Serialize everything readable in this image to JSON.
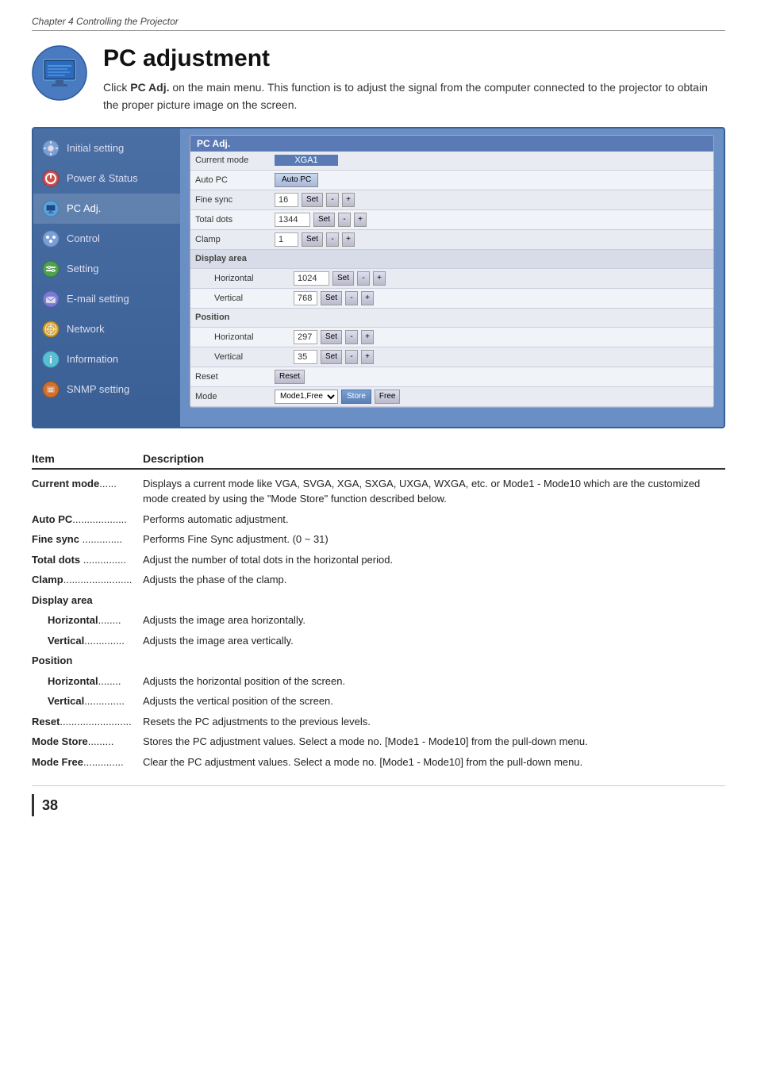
{
  "chapter": "Chapter 4 Controlling the Projector",
  "page_title": "PC adjustment",
  "intro": {
    "bold_part": "PC Adj.",
    "text": " on the main menu. This function is to adjust the signal from the computer connected to the projector to obtain the proper picture image on the screen."
  },
  "intro_prefix": "Click ",
  "sidebar": {
    "items": [
      {
        "id": "initial-setting",
        "label": "Initial setting",
        "icon": "gear"
      },
      {
        "id": "power-status",
        "label": "Power & Status",
        "icon": "power"
      },
      {
        "id": "pc-adj",
        "label": "PC Adj.",
        "icon": "monitor",
        "active": true
      },
      {
        "id": "control",
        "label": "Control",
        "icon": "control"
      },
      {
        "id": "setting",
        "label": "Setting",
        "icon": "setting"
      },
      {
        "id": "email-setting",
        "label": "E-mail setting",
        "icon": "email"
      },
      {
        "id": "network",
        "label": "Network",
        "icon": "network"
      },
      {
        "id": "information",
        "label": "Information",
        "icon": "info"
      },
      {
        "id": "snmp-setting",
        "label": "SNMP setting",
        "icon": "snmp"
      }
    ]
  },
  "panel": {
    "title": "PC Adj.",
    "rows": [
      {
        "type": "row",
        "label": "Current mode",
        "value": "XGA1",
        "value_type": "badge"
      },
      {
        "type": "row",
        "label": "Auto PC",
        "value": "Auto PC",
        "value_type": "button"
      },
      {
        "type": "row",
        "label": "Fine sync",
        "value": "16",
        "has_set": true,
        "has_pm": true
      },
      {
        "type": "row",
        "label": "Total dots",
        "value": "1344",
        "has_set": true,
        "has_pm": true
      },
      {
        "type": "row",
        "label": "Clamp",
        "value": "1",
        "has_set": true,
        "has_pm": true
      },
      {
        "type": "section",
        "label": "Display area"
      },
      {
        "type": "sub-row",
        "sub_label": "Horizontal",
        "value": "1024",
        "has_set": true,
        "has_pm": true
      },
      {
        "type": "sub-row",
        "sub_label": "Vertical",
        "value": "768",
        "has_set": true,
        "has_pm": true
      },
      {
        "type": "section",
        "label": "Position"
      },
      {
        "type": "sub-row",
        "sub_label": "Horizontal",
        "value": "297",
        "has_set": true,
        "has_pm": true
      },
      {
        "type": "sub-row",
        "sub_label": "Vertical",
        "value": "35",
        "has_set": true,
        "has_pm": true
      },
      {
        "type": "row",
        "label": "Reset",
        "value": "Reset",
        "value_type": "button"
      },
      {
        "type": "row",
        "label": "Mode",
        "value": "Mode1,Free",
        "value_type": "select",
        "extra_buttons": [
          "Store",
          "Free"
        ]
      }
    ]
  },
  "description": {
    "header_item": "Item",
    "header_desc": "Description",
    "rows": [
      {
        "item": "Current mode",
        "dots": "......",
        "text": "Displays a current mode like VGA, SVGA, XGA, SXGA, UXGA, WXGA, etc. or Mode1 - Mode10 which are the customized mode created by using the \"Mode Store\" function described below."
      },
      {
        "item": "Auto PC",
        "dots": "...................",
        "text": "Performs automatic adjustment."
      },
      {
        "item": "Fine sync",
        "dots": "..............",
        "text": "Performs Fine Sync adjustment. (0 ~ 31)"
      },
      {
        "item": "Total dots",
        "dots": "...............",
        "text": "Adjust the number of total dots in the horizontal period."
      },
      {
        "item": "Clamp",
        "dots": "........................",
        "text": "Adjusts the phase of the clamp."
      },
      {
        "item": "Display area",
        "dots": "",
        "text": "",
        "is_section": true
      },
      {
        "item": "Horizontal",
        "dots": "........",
        "text": "Adjusts the image area horizontally.",
        "sub": true
      },
      {
        "item": "Vertical",
        "dots": "..............",
        "text": "Adjusts the image area vertically.",
        "sub": true
      },
      {
        "item": "Position",
        "dots": "",
        "text": "",
        "is_section": true
      },
      {
        "item": "Horizontal",
        "dots": "........",
        "text": "Adjusts the horizontal position of the screen.",
        "sub": true
      },
      {
        "item": "Vertical",
        "dots": "..............",
        "text": "Adjusts the vertical position of the screen.",
        "sub": true
      },
      {
        "item": "Reset",
        "dots": ".........................",
        "text": "Resets the PC adjustments to the previous levels."
      },
      {
        "item": "Mode Store",
        "dots": ".........",
        "text": "Stores the PC adjustment values. Select a mode no. [Mode1 - Mode10] from the pull-down menu."
      },
      {
        "item": "Mode Free",
        "dots": "..............",
        "text": "Clear the PC adjustment values. Select a mode no.  [Mode1 - Mode10] from the pull-down menu."
      }
    ]
  },
  "page_number": "38"
}
